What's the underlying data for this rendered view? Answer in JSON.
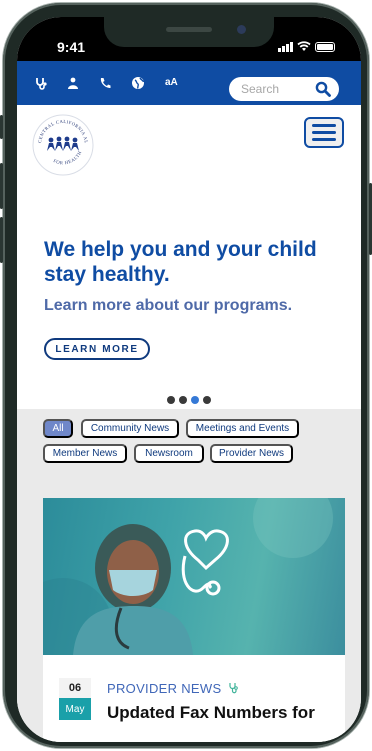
{
  "status": {
    "time": "9:41"
  },
  "utility": {
    "icons": [
      "stethoscope-icon",
      "people-icon",
      "phone-icon",
      "globe-icon",
      "text-size-icon"
    ],
    "text_size_label": "aA",
    "search_placeholder": "Search"
  },
  "logo": {
    "ring_text_top": "CENTRAL CALIFORNIA ALLIANCE",
    "ring_text_bottom": "FOR HEALTH"
  },
  "hero": {
    "title": "We help you and your child stay healthy.",
    "subtitle": "Learn more about our programs.",
    "cta_label": "LEARN MORE",
    "slide_count": 4,
    "active_slide": 3
  },
  "filters": [
    {
      "label": "All",
      "active": true
    },
    {
      "label": "Community News",
      "active": false
    },
    {
      "label": "Meetings and Events",
      "active": false
    },
    {
      "label": "Member News",
      "active": false
    },
    {
      "label": "Newsroom",
      "active": false
    },
    {
      "label": "Provider News",
      "active": false
    }
  ],
  "news_card": {
    "day": "06",
    "month": "May",
    "category": "PROVIDER NEWS",
    "title": "Updated Fax Numbers for"
  },
  "colors": {
    "brand_blue": "#0f4ca3",
    "chip_active": "#6f87c9",
    "teal": "#1aa0a9"
  }
}
